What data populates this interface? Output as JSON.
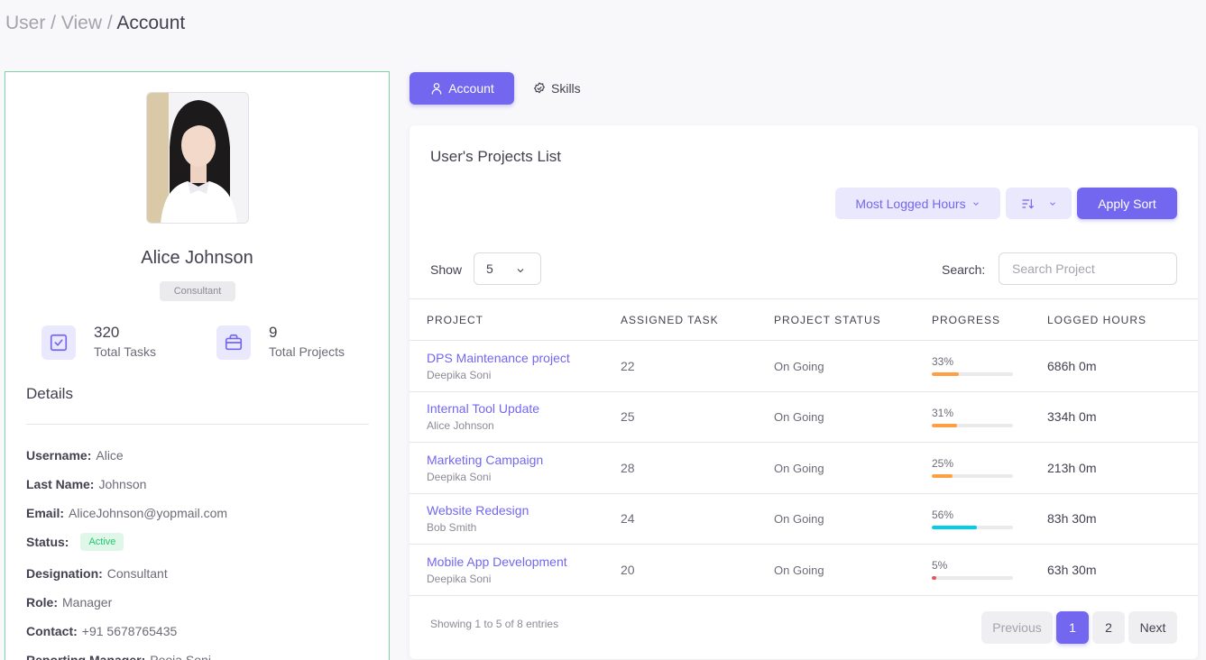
{
  "breadcrumb": {
    "part1": "User / View / ",
    "current": "Account"
  },
  "profile": {
    "name": "Alice Johnson",
    "role": "Consultant",
    "stats": [
      {
        "value": "320",
        "label": "Total Tasks",
        "icon": "checkbox-icon"
      },
      {
        "value": "9",
        "label": "Total Projects",
        "icon": "briefcase-icon"
      }
    ],
    "details_title": "Details",
    "details": {
      "username_k": "Username:",
      "username_v": "Alice",
      "lastname_k": "Last Name:",
      "lastname_v": "Johnson",
      "email_k": "Email:",
      "email_v": "AliceJohnson@yopmail.com",
      "status_k": "Status:",
      "status_v": "Active",
      "designation_k": "Designation:",
      "designation_v": "Consultant",
      "role_k": "Role:",
      "role_v": "Manager",
      "contact_k": "Contact:",
      "contact_v": "+91 5678765435",
      "manager_k": "Reporting Manager:",
      "manager_v": "Pooja Soni"
    }
  },
  "tabs": {
    "account": "Account",
    "skills": "Skills"
  },
  "projects": {
    "title": "User's Projects List",
    "sort_field": "Most Logged Hours",
    "apply_sort": "Apply Sort",
    "show_label": "Show",
    "show_value": "5",
    "search_label": "Search:",
    "search_placeholder": "Search Project",
    "columns": [
      "PROJECT",
      "ASSIGNED TASK",
      "PROJECT STATUS",
      "PROGRESS",
      "LOGGED HOURS"
    ],
    "rows": [
      {
        "name": "DPS Maintenance project",
        "owner": "Deepika Soni",
        "tasks": "22",
        "status": "On Going",
        "progress_label": "33%",
        "progress": 33,
        "color": "#ff9f43",
        "hours": "686h 0m"
      },
      {
        "name": "Internal Tool Update",
        "owner": "Alice Johnson",
        "tasks": "25",
        "status": "On Going",
        "progress_label": "31%",
        "progress": 31,
        "color": "#ff9f43",
        "hours": "334h 0m"
      },
      {
        "name": "Marketing Campaign",
        "owner": "Deepika Soni",
        "tasks": "28",
        "status": "On Going",
        "progress_label": "25%",
        "progress": 25,
        "color": "#ff9f43",
        "hours": "213h 0m"
      },
      {
        "name": "Website Redesign",
        "owner": "Bob Smith",
        "tasks": "24",
        "status": "On Going",
        "progress_label": "56%",
        "progress": 56,
        "color": "#00cfe8",
        "hours": "83h 30m"
      },
      {
        "name": "Mobile App Development",
        "owner": "Deepika Soni",
        "tasks": "20",
        "status": "On Going",
        "progress_label": "5%",
        "progress": 5,
        "color": "#ea5455",
        "hours": "63h 30m"
      }
    ],
    "showing": "Showing 1 to 5 of 8 entries",
    "pagination": {
      "prev": "Previous",
      "p1": "1",
      "p2": "2",
      "next": "Next"
    }
  }
}
